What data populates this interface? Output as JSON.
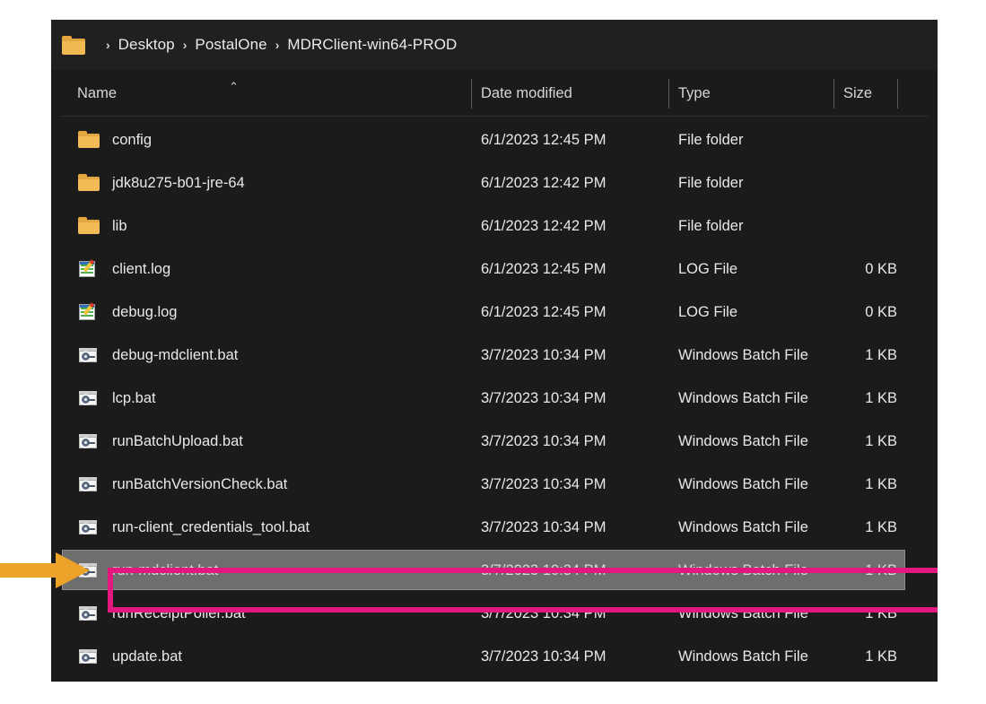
{
  "window": {
    "name": "file-explorer"
  },
  "address_bar": {
    "folder_icon": "folder-icon",
    "separator": "›",
    "crumbs": [
      "Desktop",
      "PostalOne",
      "MDRClient-win64-PROD"
    ]
  },
  "columns": {
    "headers": [
      "Name",
      "Date modified",
      "Type",
      "Size"
    ],
    "sort_caret": "⌃",
    "sorted_by": "Name",
    "sort_direction": "ascending"
  },
  "files": [
    {
      "name": "config",
      "date_modified": "6/1/2023 12:45 PM",
      "type": "File folder",
      "size": "",
      "icon": "folder-icon",
      "selected": false
    },
    {
      "name": "jdk8u275-b01-jre-64",
      "date_modified": "6/1/2023 12:42 PM",
      "type": "File folder",
      "size": "",
      "icon": "folder-icon",
      "selected": false
    },
    {
      "name": "lib",
      "date_modified": "6/1/2023 12:42 PM",
      "type": "File folder",
      "size": "",
      "icon": "folder-icon",
      "selected": false
    },
    {
      "name": "client.log",
      "date_modified": "6/1/2023 12:45 PM",
      "type": "LOG File",
      "size": "0 KB",
      "icon": "log-file-icon",
      "selected": false
    },
    {
      "name": "debug.log",
      "date_modified": "6/1/2023 12:45 PM",
      "type": "LOG File",
      "size": "0 KB",
      "icon": "log-file-icon",
      "selected": false
    },
    {
      "name": "debug-mdclient.bat",
      "date_modified": "3/7/2023 10:34 PM",
      "type": "Windows Batch File",
      "size": "1 KB",
      "icon": "batch-file-icon",
      "selected": false
    },
    {
      "name": "lcp.bat",
      "date_modified": "3/7/2023 10:34 PM",
      "type": "Windows Batch File",
      "size": "1 KB",
      "icon": "batch-file-icon",
      "selected": false
    },
    {
      "name": "runBatchUpload.bat",
      "date_modified": "3/7/2023 10:34 PM",
      "type": "Windows Batch File",
      "size": "1 KB",
      "icon": "batch-file-icon",
      "selected": false
    },
    {
      "name": "runBatchVersionCheck.bat",
      "date_modified": "3/7/2023 10:34 PM",
      "type": "Windows Batch File",
      "size": "1 KB",
      "icon": "batch-file-icon",
      "selected": false
    },
    {
      "name": "run-client_credentials_tool.bat",
      "date_modified": "3/7/2023 10:34 PM",
      "type": "Windows Batch File",
      "size": "1 KB",
      "icon": "batch-file-icon",
      "selected": false
    },
    {
      "name": "run-mdclient.bat",
      "date_modified": "3/7/2023 10:34 PM",
      "type": "Windows Batch File",
      "size": "1 KB",
      "icon": "batch-file-icon",
      "selected": true
    },
    {
      "name": "runReceiptPoller.bat",
      "date_modified": "3/7/2023 10:34 PM",
      "type": "Windows Batch File",
      "size": "1 KB",
      "icon": "batch-file-icon",
      "selected": false
    },
    {
      "name": "update.bat",
      "date_modified": "3/7/2023 10:34 PM",
      "type": "Windows Batch File",
      "size": "1 KB",
      "icon": "batch-file-icon",
      "selected": false
    }
  ],
  "annotations": {
    "highlight_box": {
      "name": "highlight-box",
      "color": "#e2187e",
      "targets": "run-mdclient.bat"
    },
    "arrow": {
      "name": "pointer-arrow",
      "color": "#eda32a",
      "direction": "right",
      "targets": "run-mdclient.bat"
    }
  },
  "colors": {
    "window_background": "#1b1b1b",
    "address_bar_background": "#202020",
    "selection_background": "#6e6e6e",
    "text": "#e9e9e9",
    "folder_accent": "#f2bb55",
    "annotation_magenta": "#e2187e",
    "annotation_orange": "#eda32a"
  }
}
